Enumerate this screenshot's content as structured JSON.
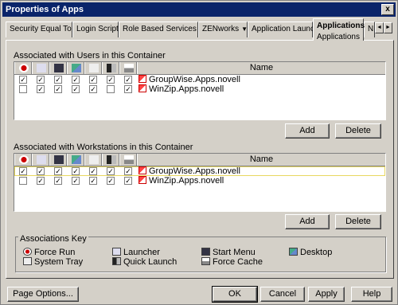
{
  "window": {
    "title": "Properties of Apps",
    "close_glyph": "x"
  },
  "tabs": [
    {
      "label": "Security Equal To Me"
    },
    {
      "label": "Login Script"
    },
    {
      "label": "Role Based Services",
      "dropdown": true
    },
    {
      "label": "ZENworks",
      "dropdown": true
    },
    {
      "label": "Application Launcher"
    },
    {
      "label": "Applications",
      "sublabel": "Applications",
      "selected": true
    },
    {
      "label": "N"
    }
  ],
  "tabnav": {
    "left": "◄",
    "right": "►"
  },
  "users_section": {
    "label": "Associated with Users in this Container",
    "name_header": "Name",
    "columns": [
      "force-run",
      "launcher",
      "start-menu",
      "desktop",
      "system-tray",
      "quick-launch",
      "force-cache"
    ],
    "rows": [
      {
        "name": "GroupWise.Apps.novell",
        "checks": [
          true,
          true,
          true,
          true,
          true,
          true,
          true
        ]
      },
      {
        "name": "WinZip.Apps.novell",
        "checks": [
          false,
          true,
          true,
          true,
          true,
          false,
          true
        ]
      }
    ],
    "add_label": "Add",
    "delete_label": "Delete"
  },
  "workstations_section": {
    "label": "Associated with Workstations in this Container",
    "name_header": "Name",
    "rows": [
      {
        "name": "GroupWise.Apps.novell",
        "checks": [
          true,
          true,
          true,
          true,
          true,
          true,
          true
        ],
        "selected": true
      },
      {
        "name": "WinZip.Apps.novell",
        "checks": [
          false,
          true,
          true,
          true,
          true,
          true,
          true
        ]
      }
    ],
    "add_label": "Add",
    "delete_label": "Delete"
  },
  "associations_key": {
    "title": "Associations Key",
    "items": [
      {
        "icon": "force-run-icon",
        "label": "Force Run"
      },
      {
        "icon": "launcher-icon",
        "label": "Launcher"
      },
      {
        "icon": "start-menu-icon",
        "label": "Start Menu"
      },
      {
        "icon": "desktop-icon",
        "label": "Desktop"
      },
      {
        "icon": "system-tray-icon",
        "label": "System Tray"
      },
      {
        "icon": "quick-launch-icon",
        "label": "Quick Launch"
      },
      {
        "icon": "force-cache-icon",
        "label": "Force Cache"
      }
    ]
  },
  "footer": {
    "page_options": "Page Options...",
    "ok": "OK",
    "cancel": "Cancel",
    "apply": "Apply",
    "help": "Help"
  }
}
